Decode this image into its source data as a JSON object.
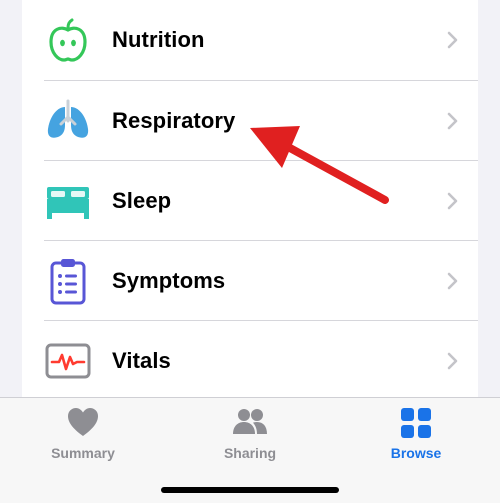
{
  "browse_list": {
    "items": [
      {
        "label": "Nutrition",
        "icon": "apple-icon"
      },
      {
        "label": "Respiratory",
        "icon": "lungs-icon"
      },
      {
        "label": "Sleep",
        "icon": "bed-icon"
      },
      {
        "label": "Symptoms",
        "icon": "clipboard-icon"
      },
      {
        "label": "Vitals",
        "icon": "heart-rate-monitor-icon"
      }
    ]
  },
  "tab_bar": {
    "tabs": [
      {
        "label": "Summary",
        "icon": "heart-icon",
        "active": false
      },
      {
        "label": "Sharing",
        "icon": "people-icon",
        "active": false
      },
      {
        "label": "Browse",
        "icon": "grid-icon",
        "active": true
      }
    ]
  },
  "colors": {
    "nutrition_green": "#34c759",
    "respiratory_blue": "#45a3e0",
    "sleep_teal": "#30c5b8",
    "symptoms_indigo": "#5856d6",
    "vitals_red": "#ff3b30",
    "tab_active_blue": "#1a73e8",
    "tab_inactive_gray": "#8e8e93",
    "annotation_arrow_red": "#e02020"
  }
}
